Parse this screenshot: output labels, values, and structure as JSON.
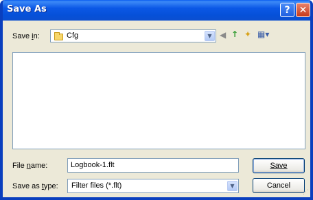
{
  "window": {
    "title": "Save As"
  },
  "title_buttons": {
    "help": "?",
    "close": "✕"
  },
  "save_in": {
    "label_prefix": "Save ",
    "label_hotkey": "i",
    "label_suffix": "n:",
    "value": "Cfg",
    "arrow": "▼"
  },
  "toolbar": {
    "back": "◀",
    "up": "↑",
    "new_folder": "✦",
    "views": "▦▾"
  },
  "file_name": {
    "label_prefix": "File ",
    "label_hotkey": "n",
    "label_suffix": "ame:",
    "value": "Logbook-1.flt"
  },
  "save_as_type": {
    "label_prefix": "Save as ",
    "label_hotkey": "t",
    "label_suffix": "ype:",
    "value": "Filter files (*.flt)",
    "arrow": "▼"
  },
  "buttons": {
    "save": "Save",
    "cancel": "Cancel"
  },
  "grip": "⋰"
}
